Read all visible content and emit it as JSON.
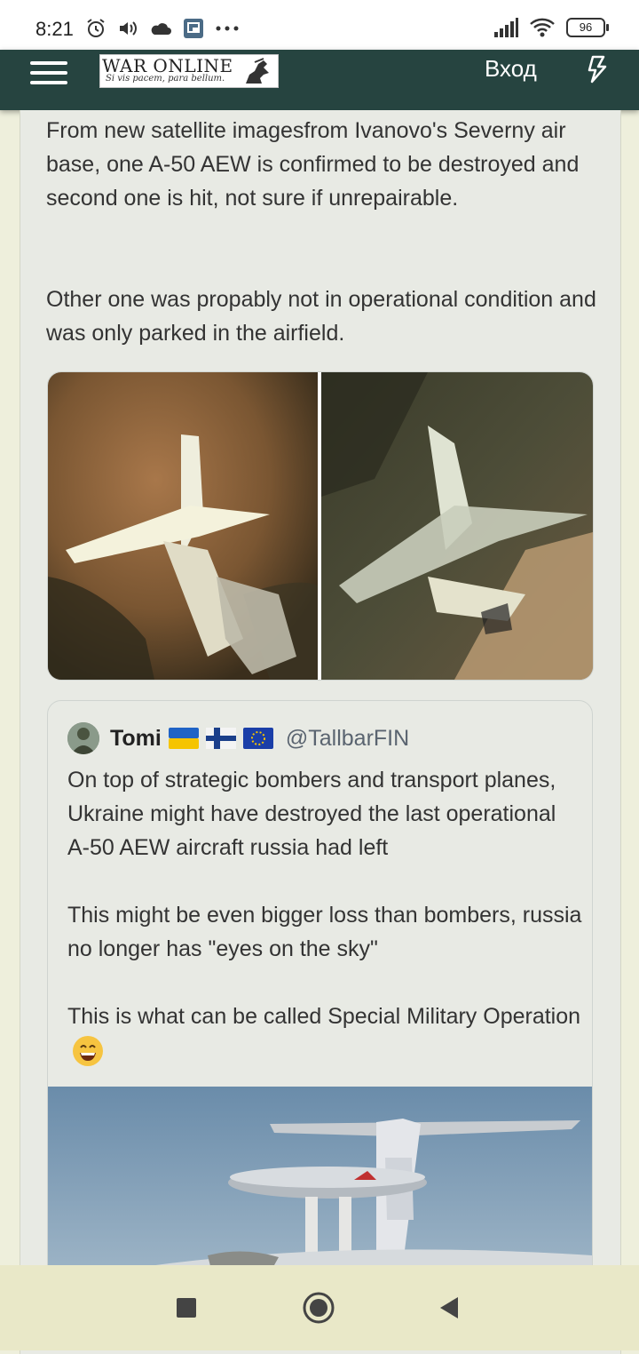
{
  "status_bar": {
    "time": "8:21",
    "battery": "96"
  },
  "header": {
    "logo_title": "WAR ONLINE",
    "logo_motto": "Si vis pacem, para bellum.",
    "login_label": "Вход"
  },
  "post": {
    "paragraph_1": "From new satellite imagesfrom Ivanovo's Severny air base, one A-50 AEW is confirmed to be destroyed and second one is hit, not sure if unrepairable.",
    "paragraph_2": "Other one was propably not in operational condition and was only parked in the airfield."
  },
  "quoted_tweet": {
    "author_name": "Tomi",
    "author_handle": "@TallbarFIN",
    "paragraph_1": "On top of strategic bombers and transport planes, Ukraine might have destroyed the last operational A-50 AEW aircraft russia had left",
    "paragraph_2": "This might be even bigger loss than bombers, russia no longer has \"eyes on the sky\"",
    "paragraph_3": "This is what can be called Special Military Operation"
  },
  "colors": {
    "navbar": "#264440",
    "page_bg": "#eeefdc",
    "card_bg": "#e8eae4",
    "bottom_nav": "#e9e8c8"
  },
  "icons": [
    "alarm-icon",
    "volume-icon",
    "cloud-icon",
    "cast-icon",
    "more-dots-icon",
    "signal-icon",
    "wifi-icon",
    "battery-icon",
    "menu-icon",
    "lightning-icon",
    "stop-icon",
    "home-icon",
    "back-icon",
    "grinning-emoji"
  ]
}
